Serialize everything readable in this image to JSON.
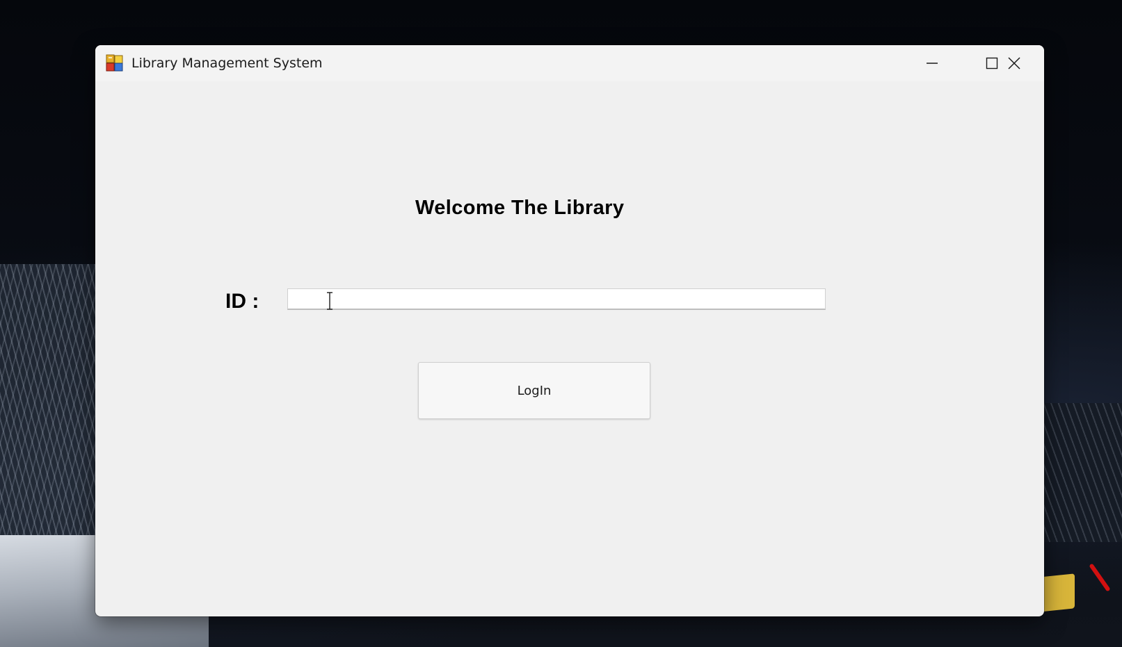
{
  "window": {
    "title": "Library Management System",
    "icon": "app-window-icon"
  },
  "caption_buttons": {
    "minimize_icon": "minimize-icon",
    "maximize_icon": "maximize-icon",
    "close_icon": "close-icon"
  },
  "form": {
    "heading": "Welcome The Library",
    "id_label": "ID :",
    "id_value": "",
    "id_placeholder": "",
    "login_label": "LogIn"
  },
  "colors": {
    "window_background": "#f0f0f0",
    "titlebar_background": "#f3f3f3",
    "input_background": "#ffffff",
    "button_background": "#f7f7f7",
    "text": "#000000"
  }
}
